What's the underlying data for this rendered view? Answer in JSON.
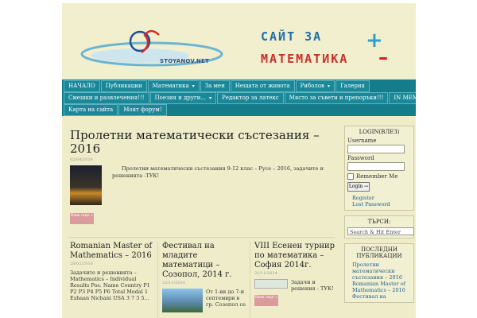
{
  "colors": {
    "nav_bg": "#157c8c",
    "page_bg": "#efedc9",
    "more_button": "#d89c9c",
    "link": "#1f5e8a"
  },
  "header": {
    "logo_text": "STOYANOV.NET",
    "slogan_line1": "САЙТ ЗА",
    "slogan_line2": "МАТЕМАТИКА",
    "plus": "+",
    "minus": "–"
  },
  "nav": {
    "row1": [
      {
        "label": "НАЧАЛО",
        "arrow": false
      },
      {
        "label": "Публикации",
        "arrow": false
      },
      {
        "label": "Математика",
        "arrow": true
      },
      {
        "label": "За мен",
        "arrow": false
      },
      {
        "label": "Нещата от живота",
        "arrow": false
      },
      {
        "label": "Риболов",
        "arrow": true
      },
      {
        "label": "Галерия",
        "arrow": false
      }
    ],
    "row2": [
      {
        "label": "Смешки и развлечения!!!",
        "arrow": false
      },
      {
        "label": "Поезия и други...",
        "arrow": true
      },
      {
        "label": "Редактор за латекс",
        "arrow": false
      },
      {
        "label": "Място за съвети и препоръки!!!",
        "arrow": false
      },
      {
        "label": "IN MEMORIAM",
        "arrow": false
      }
    ],
    "row3": [
      {
        "label": "Карта на сайта",
        "arrow": false
      },
      {
        "label": "Моят форум!",
        "arrow": false
      }
    ]
  },
  "featured": {
    "title": "Пролетни математически състезания – 2016",
    "date": "02/04/2016",
    "excerpt": "Пролетни математически състезания 9-12 клас – Русе – 2016, задачите и решенията -ТУК!",
    "more": "Виж още »"
  },
  "cards": [
    {
      "title": "Romanian Master of Mathematics – 2016",
      "date": "28/02/2016",
      "body": "Задачите и решенията – Mathematics – Individual Results Pos. Name Country P1 P2 P3 P4 P5 P6 Total Medal 1 Eshaan Nichani USA 3 7 3 5..."
    },
    {
      "title": "Фестивал на младите математици – Созопол, 2014 г.",
      "date": "23/11/2014",
      "body": "От 1-ви до 7-и септември в гр. Созопол се"
    },
    {
      "title": "VIII Есенен турнир по математика – София 2014г.",
      "date": "21/11/2014",
      "body": "Задачи и решения - ТУК!",
      "more": "Виж още »"
    }
  ],
  "sidebar": {
    "login_title": "LOGIN(ВЛЕЗ)",
    "username_label": "Username",
    "password_label": "Password",
    "remember_label": "Remember Me",
    "login_button": "Login →",
    "register": "Register",
    "lost_password": "Lost Password",
    "search_title": "ТЪРСИ:",
    "search_value": "Search & Hit Enter",
    "recent_title": "ПОСЛЕДНИ ПУБЛИКАЦИИ",
    "recent": [
      "Пролетни математически състезания – 2016",
      "Romanian Master of Mathematics – 2016",
      "Фестивал на"
    ]
  }
}
